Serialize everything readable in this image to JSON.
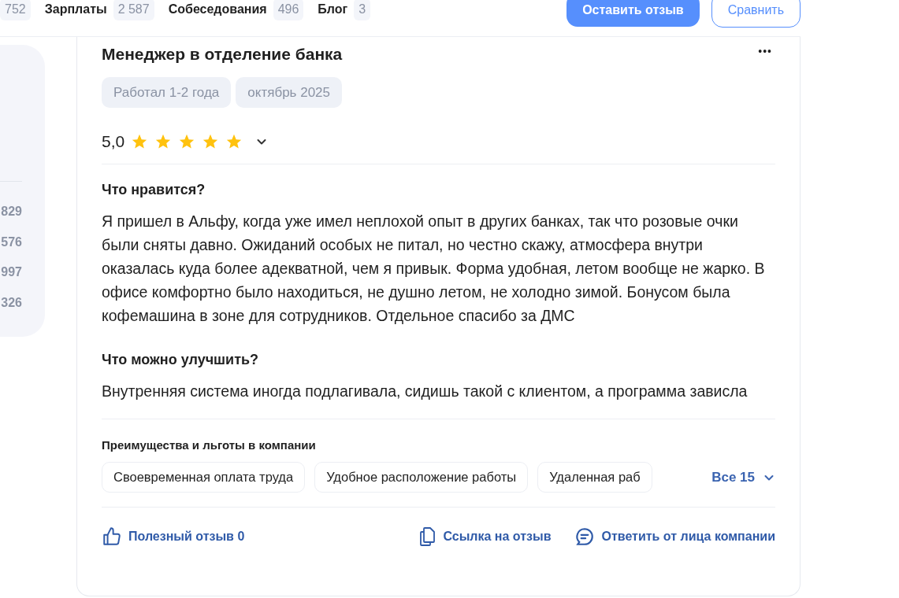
{
  "nav": {
    "tabs": [
      {
        "count": "752"
      },
      {
        "label": "Зарплаты",
        "count": "2 587"
      },
      {
        "label": "Собеседования",
        "count": "496"
      },
      {
        "label": "Блог",
        "count": "3"
      }
    ],
    "buttons": [
      {
        "kind": "primary",
        "label": "Оставить отзыв"
      },
      {
        "kind": "outline",
        "label": "Сравнить"
      }
    ]
  },
  "side_panel": {
    "counts": [
      "829",
      "576",
      "997",
      "326"
    ]
  },
  "review": {
    "title": "Менеджер в отделение банка",
    "more": "•••",
    "tags": [
      "Работал 1-2 года",
      "октябрь 2025"
    ],
    "rating": "5,0",
    "stars": 5,
    "sections": [
      {
        "heading": "Что нравится?",
        "text": "Я пришел в Альфу, когда уже имел неплохой опыт в других банках, так что розовые очки были сняты давно. Ожиданий особых не питал, но честно скажу, атмосфера внутри оказалась куда более адекватной, чем я привык. Форма удобная, летом вообще не жарко. В офисе комфортно было находиться, не душно летом, не холодно зимой. Бонусом была кофемашина в зоне для сотрудников. Отдельное спасибо за ДМС"
      },
      {
        "heading": "Что можно улучшить?",
        "text": "Внутренняя система иногда подлагивала, сидишь такой с клиентом, а программа зависла"
      }
    ],
    "benefits": {
      "heading": "Преимущества и льготы в компании",
      "items": [
        "Своевременная оплата труда",
        "Удобное расположение работы",
        "Удаленная раб"
      ],
      "all": "Все 15"
    },
    "actions": [
      {
        "kind": "like",
        "label": "Полезный отзыв 0"
      },
      {
        "kind": "link",
        "label": "Ссылка на отзыв"
      },
      {
        "kind": "reply",
        "label": "Ответить от лица компании"
      }
    ]
  }
}
